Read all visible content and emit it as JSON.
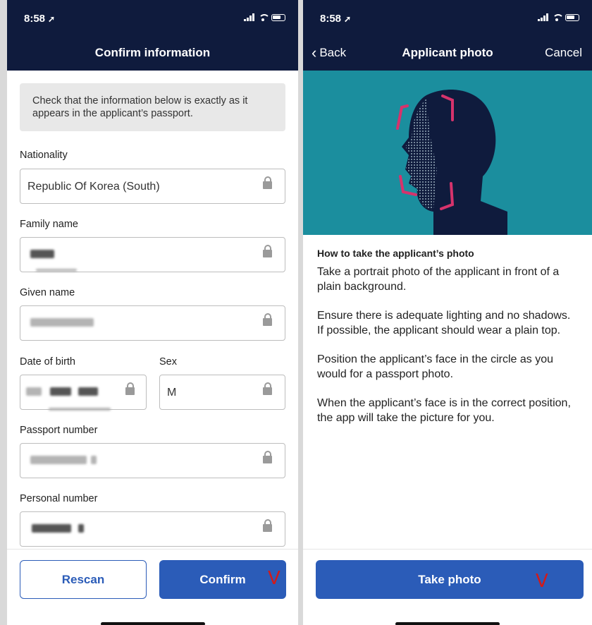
{
  "left_screen": {
    "status_time": "8:58",
    "title": "Confirm information",
    "notice": "Check that the information below is exactly as it appears in the applicant’s passport.",
    "fields": {
      "nationality": {
        "label": "Nationality",
        "value": "Republic Of Korea (South)"
      },
      "family_name": {
        "label": "Family name"
      },
      "given_name": {
        "label": "Given name"
      },
      "date_of_birth": {
        "label": "Date of birth"
      },
      "sex": {
        "label": "Sex",
        "value": "M"
      },
      "passport_number": {
        "label": "Passport number"
      },
      "personal_number": {
        "label": "Personal number"
      }
    },
    "rescan_label": "Rescan",
    "confirm_label": "Confirm",
    "handwritten_mark": "V"
  },
  "right_screen": {
    "status_time": "8:58",
    "back_label": "Back",
    "title": "Applicant photo",
    "cancel_label": "Cancel",
    "instructions_title": "How to take the applicant’s photo",
    "paragraphs": [
      "Take a portrait photo of the applicant in front of a plain background.",
      "Ensure there is adequate lighting and no shadows. If possible, the applicant should wear a plain top.",
      "Position the applicant’s face in the circle as you would for a passport photo.",
      "When the applicant’s face is in the correct position, the app will take the picture for you."
    ],
    "take_photo_label": "Take photo",
    "handwritten_mark": "V"
  },
  "colors": {
    "navy": "#0f1b3d",
    "primary_button": "#2b5cb8",
    "hero_teal": "#1b8e9e",
    "corner_accent": "#d6336c"
  },
  "icons": [
    "location-arrow-icon",
    "signal-icon",
    "wifi-icon",
    "battery-icon",
    "lock-icon",
    "chevron-left-icon",
    "face-scan-illustration"
  ]
}
